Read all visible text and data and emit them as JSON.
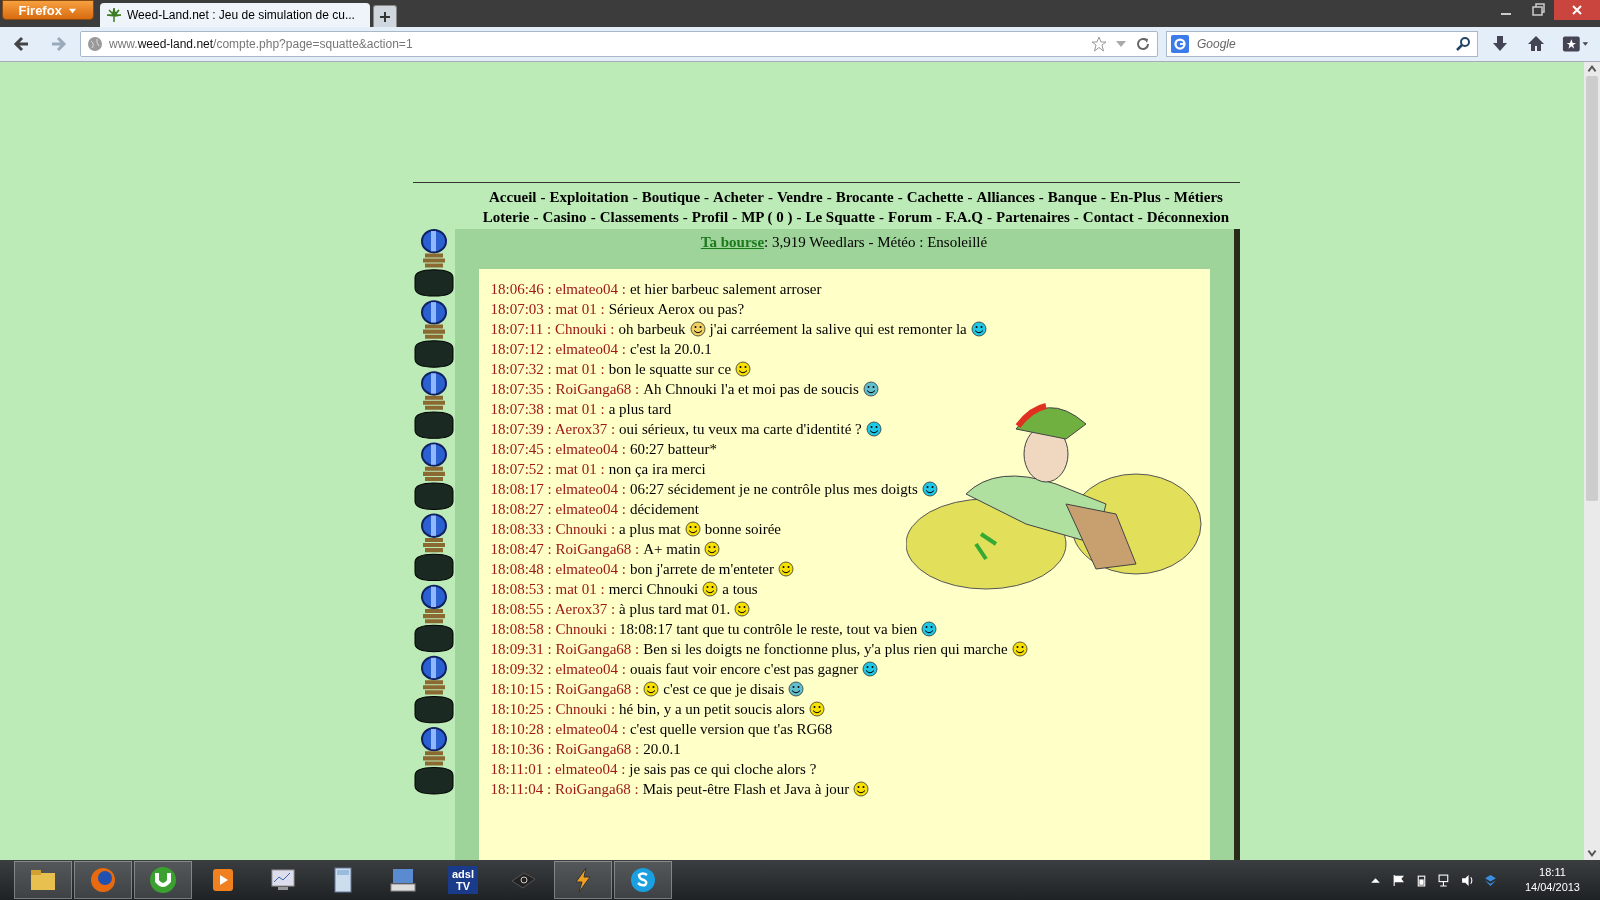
{
  "browser": {
    "menu_button": "Firefox",
    "tab": {
      "title": "Weed-Land.net : Jeu de simulation de cu...",
      "selected": true
    },
    "url": {
      "prefix": "www.",
      "domain": "weed-land.net",
      "path": "/compte.php?page=squatte&action=1"
    },
    "search": {
      "placeholder": "Google"
    }
  },
  "nav": {
    "separator": "-",
    "rows": [
      [
        "Accueil",
        "Exploitation",
        "Boutique",
        "Acheter",
        "Vendre",
        "Brocante",
        "Cachette",
        "Alliances",
        "Banque",
        "En-Plus",
        "Métiers"
      ],
      [
        "Loterie",
        "Casino",
        "Classements",
        "Profil",
        "MP ( 0 )",
        "Le Squatte",
        "Forum",
        "F.A.Q",
        "Partenaires",
        "Contact",
        "Déconnexion"
      ]
    ]
  },
  "chat_separator": ":",
  "status": {
    "link": "Ta bourse",
    "text": ": 3,919 Weedlars - Météo : Ensoleillé"
  },
  "messages": [
    {
      "time": "18:06:46",
      "user": "elmateo04",
      "parts": [
        {
          "kind": "text",
          "text": "et hier barbeuc salement arroser"
        }
      ]
    },
    {
      "time": "18:07:03",
      "user": "mat 01",
      "parts": [
        {
          "kind": "text",
          "text": "Sérieux Aerox ou pas?"
        }
      ]
    },
    {
      "time": "18:07:11",
      "user": "Chnouki",
      "parts": [
        {
          "kind": "text",
          "text": "oh barbeuk"
        },
        {
          "kind": "emoticon",
          "color": "#f0d060"
        },
        {
          "kind": "text",
          "text": "j'ai carréement la salive qui est remonter la"
        },
        {
          "kind": "emoticon",
          "color": "#20c8e8"
        }
      ]
    },
    {
      "time": "18:07:12",
      "user": "elmateo04",
      "parts": [
        {
          "kind": "text",
          "text": "c'est la 20.0.1"
        }
      ]
    },
    {
      "time": "18:07:32",
      "user": "mat 01",
      "parts": [
        {
          "kind": "text",
          "text": "bon le squatte sur ce"
        },
        {
          "kind": "emoticon",
          "color": "#f8e000"
        }
      ]
    },
    {
      "time": "18:07:35",
      "user": "RoiGanga68",
      "parts": [
        {
          "kind": "text",
          "text": "Ah Chnouki l'a et moi pas de soucis"
        },
        {
          "kind": "emoticon",
          "color": "#60c0d0"
        }
      ]
    },
    {
      "time": "18:07:38",
      "user": "mat 01",
      "parts": [
        {
          "kind": "text",
          "text": "a plus tard"
        }
      ]
    },
    {
      "time": "18:07:39",
      "user": "Aerox37",
      "parts": [
        {
          "kind": "text",
          "text": "oui sérieux, tu veux ma carte d'identité ?"
        },
        {
          "kind": "emoticon",
          "color": "#20c8e8"
        }
      ]
    },
    {
      "time": "18:07:45",
      "user": "elmateo04",
      "parts": [
        {
          "kind": "text",
          "text": "60:27 batteur*"
        }
      ]
    },
    {
      "time": "18:07:52",
      "user": "mat 01",
      "parts": [
        {
          "kind": "text",
          "text": "non ça ira merci"
        }
      ]
    },
    {
      "time": "18:08:17",
      "user": "elmateo04",
      "parts": [
        {
          "kind": "text",
          "text": "06:27 sécidement je ne contrôle plus mes doigts"
        },
        {
          "kind": "emoticon",
          "color": "#20c8e8"
        }
      ]
    },
    {
      "time": "18:08:27",
      "user": "elmateo04",
      "parts": [
        {
          "kind": "text",
          "text": "décidement"
        }
      ]
    },
    {
      "time": "18:08:33",
      "user": "Chnouki",
      "parts": [
        {
          "kind": "text",
          "text": "a plus mat"
        },
        {
          "kind": "emoticon",
          "color": "#f8e000"
        },
        {
          "kind": "text",
          "text": "bonne soirée"
        }
      ]
    },
    {
      "time": "18:08:47",
      "user": "RoiGanga68",
      "parts": [
        {
          "kind": "text",
          "text": "A+ matin"
        },
        {
          "kind": "emoticon",
          "color": "#f8e000"
        }
      ]
    },
    {
      "time": "18:08:48",
      "user": "elmateo04",
      "parts": [
        {
          "kind": "text",
          "text": "bon j'arrete de m'enteter"
        },
        {
          "kind": "emoticon",
          "color": "#f8e000"
        }
      ]
    },
    {
      "time": "18:08:53",
      "user": "mat 01",
      "parts": [
        {
          "kind": "text",
          "text": "merci Chnouki"
        },
        {
          "kind": "emoticon",
          "color": "#f8e000"
        },
        {
          "kind": "text",
          "text": "a tous"
        }
      ]
    },
    {
      "time": "18:08:55",
      "user": "Aerox37",
      "parts": [
        {
          "kind": "text",
          "text": "à plus tard mat 01."
        },
        {
          "kind": "emoticon",
          "color": "#f8e000"
        }
      ]
    },
    {
      "time": "18:08:58",
      "user": "Chnouki",
      "parts": [
        {
          "kind": "text",
          "text": "18:08:17 tant que tu contrôle le reste, tout va bien"
        },
        {
          "kind": "emoticon",
          "color": "#20c8e8"
        }
      ]
    },
    {
      "time": "18:09:31",
      "user": "RoiGanga68",
      "parts": [
        {
          "kind": "text",
          "text": "Ben si les doigts ne fonctionne plus, y'a plus rien qui marche"
        },
        {
          "kind": "emoticon",
          "color": "#f8e000"
        }
      ]
    },
    {
      "time": "18:09:32",
      "user": "elmateo04",
      "parts": [
        {
          "kind": "text",
          "text": "ouais faut voir encore c'est pas gagner"
        },
        {
          "kind": "emoticon",
          "color": "#20c8e8"
        }
      ]
    },
    {
      "time": "18:10:15",
      "user": "RoiGanga68",
      "parts": [
        {
          "kind": "emoticon",
          "color": "#f8e000"
        },
        {
          "kind": "text",
          "text": "c'est ce que je disais"
        },
        {
          "kind": "emoticon",
          "color": "#60c0d0"
        }
      ]
    },
    {
      "time": "18:10:25",
      "user": "Chnouki",
      "parts": [
        {
          "kind": "text",
          "text": "hé bin, y a un petit soucis alors"
        },
        {
          "kind": "emoticon",
          "color": "#f8e000"
        }
      ]
    },
    {
      "time": "18:10:28",
      "user": "elmateo04",
      "parts": [
        {
          "kind": "text",
          "text": "c'est quelle version que t'as RG68"
        }
      ]
    },
    {
      "time": "18:10:36",
      "user": "RoiGanga68",
      "parts": [
        {
          "kind": "text",
          "text": "20.0.1"
        }
      ]
    },
    {
      "time": "18:11:01",
      "user": "elmateo04",
      "parts": [
        {
          "kind": "text",
          "text": "je sais pas ce qui cloche alors ?"
        }
      ]
    },
    {
      "time": "18:11:04",
      "user": "RoiGanga68",
      "parts": [
        {
          "kind": "text",
          "text": "Mais peut-être Flash et Java à jour"
        },
        {
          "kind": "emoticon",
          "color": "#f8e000"
        }
      ]
    }
  ],
  "taskbar": {
    "tv_label": "adsl TV",
    "time": "18:11",
    "date": "14/04/2013"
  }
}
